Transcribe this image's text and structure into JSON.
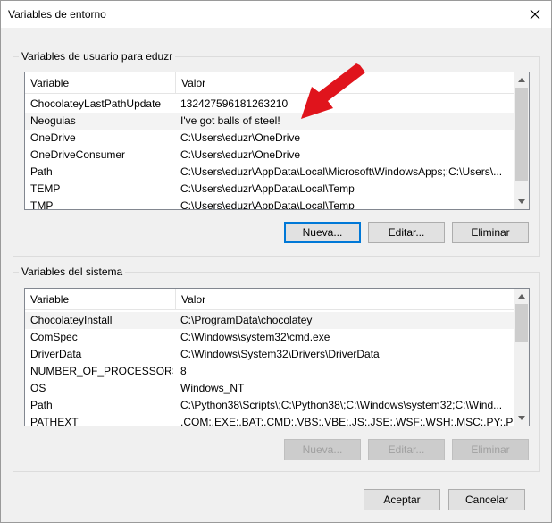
{
  "dialog": {
    "title": "Variables de entorno",
    "close_label": "×"
  },
  "user": {
    "group_label": "Variables de usuario para eduzr",
    "columns": [
      "Variable",
      "Valor"
    ],
    "rows": [
      {
        "name": "ChocolateyLastPathUpdate",
        "value": "132427596181263210"
      },
      {
        "name": "Neoguias",
        "value": "I've got balls of steel!"
      },
      {
        "name": "OneDrive",
        "value": "C:\\Users\\eduzr\\OneDrive"
      },
      {
        "name": "OneDriveConsumer",
        "value": "C:\\Users\\eduzr\\OneDrive"
      },
      {
        "name": "Path",
        "value": "C:\\Users\\eduzr\\AppData\\Local\\Microsoft\\WindowsApps;;C:\\Users\\..."
      },
      {
        "name": "TEMP",
        "value": "C:\\Users\\eduzr\\AppData\\Local\\Temp"
      },
      {
        "name": "TMP",
        "value": "C:\\Users\\eduzr\\AppData\\Local\\Temp"
      }
    ],
    "buttons": {
      "new": "Nueva...",
      "edit": "Editar...",
      "delete": "Eliminar"
    }
  },
  "system": {
    "group_label": "Variables del sistema",
    "columns": [
      "Variable",
      "Valor"
    ],
    "rows": [
      {
        "name": "ChocolateyInstall",
        "value": "C:\\ProgramData\\chocolatey"
      },
      {
        "name": "ComSpec",
        "value": "C:\\Windows\\system32\\cmd.exe"
      },
      {
        "name": "DriverData",
        "value": "C:\\Windows\\System32\\Drivers\\DriverData"
      },
      {
        "name": "NUMBER_OF_PROCESSORS",
        "value": "8"
      },
      {
        "name": "OS",
        "value": "Windows_NT"
      },
      {
        "name": "Path",
        "value": "C:\\Python38\\Scripts\\;C:\\Python38\\;C:\\Windows\\system32;C:\\Wind..."
      },
      {
        "name": "PATHEXT",
        "value": ".COM;.EXE;.BAT;.CMD;.VBS;.VBE;.JS;.JSE;.WSF;.WSH;.MSC;.PY;.PYW"
      }
    ],
    "buttons": {
      "new": "Nueva...",
      "edit": "Editar...",
      "delete": "Eliminar"
    }
  },
  "footer": {
    "ok": "Aceptar",
    "cancel": "Cancelar"
  },
  "colors": {
    "annotation_arrow": "#e0141c",
    "focus_border": "#0078d7"
  }
}
